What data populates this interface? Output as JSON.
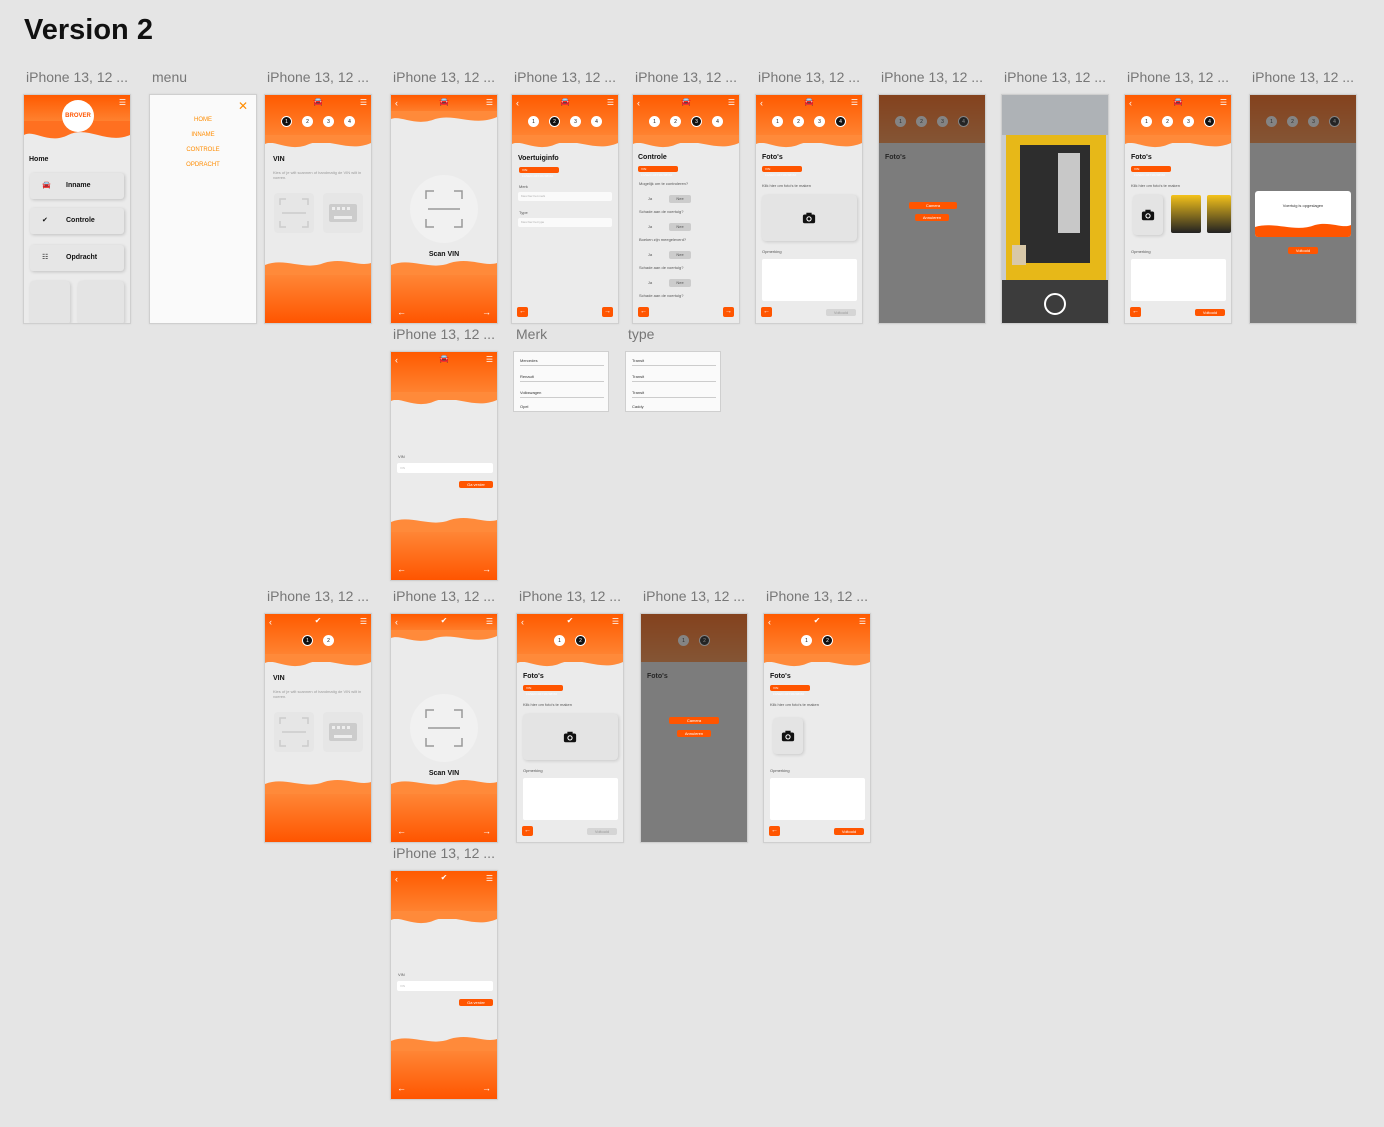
{
  "page": {
    "title": "Version 2"
  },
  "labels": {
    "iphone": "iPhone 13, 12 ...",
    "menu": "menu",
    "merk": "Merk",
    "type": "type"
  },
  "colors": {
    "accent": "#ff5500",
    "accent_light": "#ff8a3a",
    "background": "#e5e5e5",
    "menu_text": "#ff8c00"
  },
  "home": {
    "logo": "BROVER",
    "heading": "Home",
    "buttons": [
      {
        "label": "Inname",
        "icon": "car-icon"
      },
      {
        "label": "Controle",
        "icon": "check-icon"
      },
      {
        "label": "Opdracht",
        "icon": "list-icon"
      }
    ]
  },
  "menu": {
    "close": "✕",
    "items": [
      "HOME",
      "INNAME",
      "CONTROLE",
      "OPDRACHT"
    ]
  },
  "steps4": [
    "1",
    "2",
    "3",
    "4"
  ],
  "steps2": [
    "1",
    "2"
  ],
  "vin": {
    "title": "VIN",
    "text": "Kies of je wilt scannen of handmatig de VIN wilt in voeren.",
    "scan_label": "Scan VIN",
    "field_label": "VIN",
    "placeholder": "VIN",
    "next_button": "Ga verder"
  },
  "voertuig": {
    "title": "Voertuiginfo",
    "vin_pill": "VIN: 1GNEK13ZX3R298984",
    "merk_label": "Merk",
    "merk_placeholder": "Kies hier het merk",
    "type_label": "Type",
    "type_placeholder": "Kies hier het type"
  },
  "controle": {
    "title": "Controle",
    "questions": [
      "Mogelijk om te controleren?",
      "Schade aan de voertuig?",
      "Boeken zijn meegeleverd?",
      "Schade aan de voertuig?",
      "Schade aan de voertuig?"
    ],
    "ja": "Ja",
    "nee": "Nee"
  },
  "fotos": {
    "title": "Foto's",
    "hint": "Klik hier om foto's te maken",
    "remark_label": "Opmerking",
    "done_button": "Voltooid",
    "camera_option": "Camera",
    "gallery_option": "Annuleren"
  },
  "modal": {
    "text": "Voertuig is opgeslagen",
    "button": "Voltooid"
  },
  "merk_list": [
    "Mercedes",
    "Renault",
    "Volkswagen",
    "Opel"
  ],
  "type_list": [
    "Transit",
    "Transit",
    "Transit",
    "Caddy"
  ]
}
